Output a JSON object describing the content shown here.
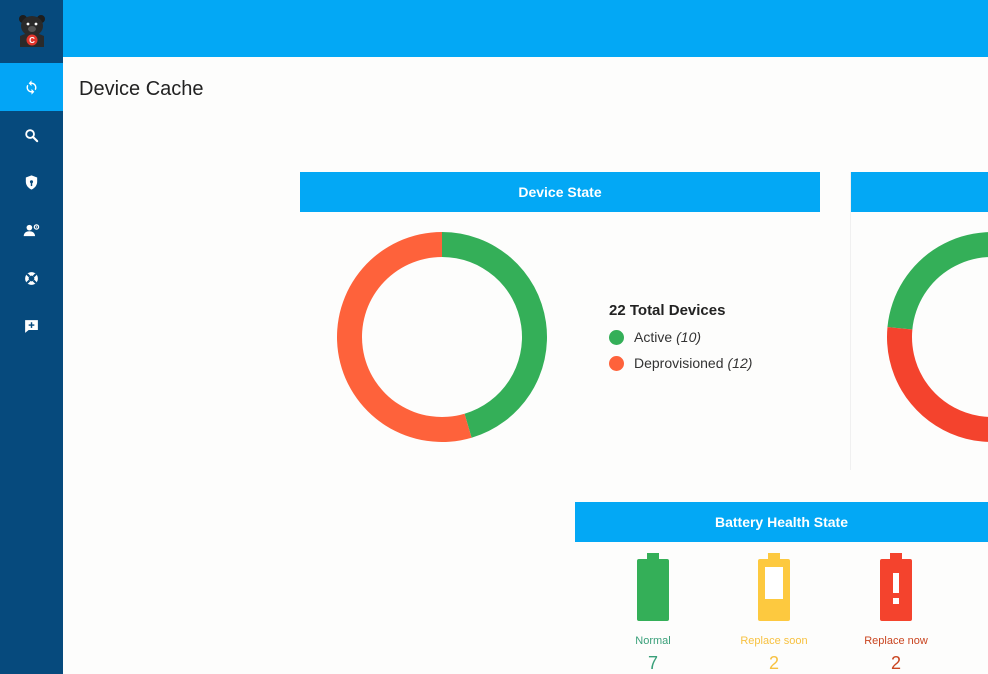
{
  "app": {
    "logo_icon": "bear-logo-icon",
    "nav": [
      {
        "id": "device-cache",
        "icon": "sync-icon",
        "active": true
      },
      {
        "id": "search",
        "icon": "search-icon",
        "active": false
      },
      {
        "id": "security",
        "icon": "shield-icon",
        "active": false
      },
      {
        "id": "users",
        "icon": "user-settings-icon",
        "active": false
      },
      {
        "id": "support",
        "icon": "lifebuoy-icon",
        "active": false
      },
      {
        "id": "feedback",
        "icon": "add-comment-icon",
        "active": false
      }
    ]
  },
  "page": {
    "title": "Device Cache"
  },
  "device_state": {
    "header": "Device State",
    "total_label": "22 Total Devices",
    "items": [
      {
        "label": "Active",
        "count": "(10)",
        "value": 10,
        "color": "#34af58"
      },
      {
        "label": "Deprovisioned",
        "count": "(12)",
        "value": 12,
        "color": "#fe623b"
      }
    ]
  },
  "second_chart": {
    "header": "",
    "items": [
      {
        "value": 60,
        "color": "#34af58"
      },
      {
        "value": 40,
        "color": "#f4432d"
      }
    ]
  },
  "battery": {
    "header": "Battery Health State",
    "items": [
      {
        "label": "Normal",
        "count": "7",
        "color": "#34af58",
        "label_color": "#3aa07a",
        "icon": "battery-full-icon"
      },
      {
        "label": "Replace soon",
        "count": "2",
        "color": "#fdc93f",
        "label_color": "#f7c140",
        "icon": "battery-low-icon"
      },
      {
        "label": "Replace now",
        "count": "2",
        "color": "#f4432d",
        "label_color": "#c94520",
        "icon": "battery-alert-icon"
      }
    ]
  }
}
